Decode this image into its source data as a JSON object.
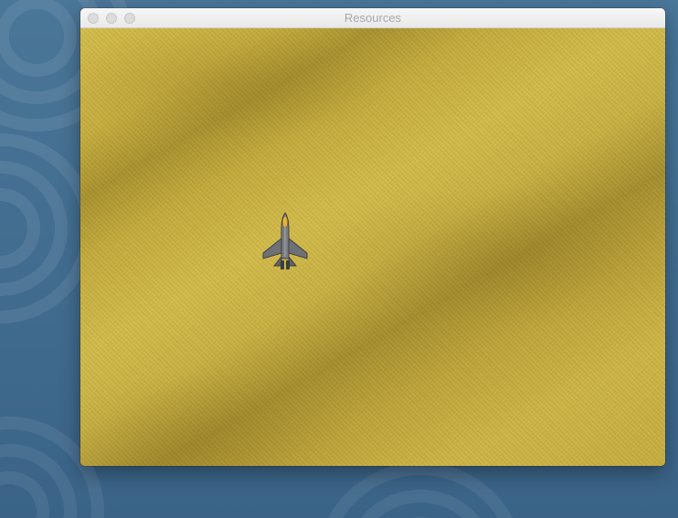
{
  "window": {
    "title": "Resources"
  },
  "colors": {
    "desktop": "#3e6a90",
    "sand": "#c9b142",
    "sand_shadow": "#a58e2d",
    "jet_body": "#6e7176",
    "jet_flame": "#e8b23a"
  },
  "game": {
    "background": "sand-texture",
    "player_sprite": "fighter-jet-icon"
  }
}
